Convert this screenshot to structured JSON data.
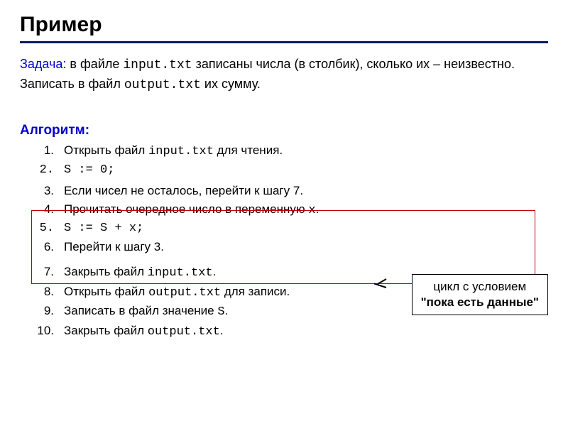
{
  "title": "Пример",
  "task": {
    "label": "Задача:",
    "textPrefix": " в файле ",
    "file1": "input.txt",
    "textMid1": " записаны числа (в столбик), сколько их – неизвестно. Записать в файл ",
    "file2": "output.txt",
    "textMid2": " их сумму."
  },
  "algo": {
    "label": "Алгоритм:",
    "steps": [
      {
        "num": "1.",
        "prefix": "Открыть файл ",
        "code": "input.txt",
        "suffix": " для чтения."
      },
      {
        "num": "2.",
        "code": "S := 0;"
      },
      {
        "num": "3.",
        "text": "Если чисел не осталось, перейти к шагу 7."
      },
      {
        "num": "4.",
        "prefix": "Прочитать очередное число в переменную ",
        "code": "x",
        "suffix": "."
      },
      {
        "num": "5.",
        "code": "S := S + x;"
      },
      {
        "num": "6.",
        "text": "Перейти к шагу 3."
      },
      {
        "num": "7.",
        "prefix": "Закрыть файл ",
        "code": "input.txt",
        "suffix": "."
      },
      {
        "num": "8.",
        "prefix": "Открыть файл ",
        "code": "output.txt",
        "suffix": " для записи."
      },
      {
        "num": "9.",
        "prefix": "Записать в файл значение ",
        "code": "S",
        "suffix": "."
      },
      {
        "num": "10.",
        "prefix": "Закрыть файл ",
        "code": "output.txt",
        "suffix": "."
      }
    ]
  },
  "callout": {
    "line1": "цикл с условием",
    "line2": "\"пока есть данные\""
  }
}
